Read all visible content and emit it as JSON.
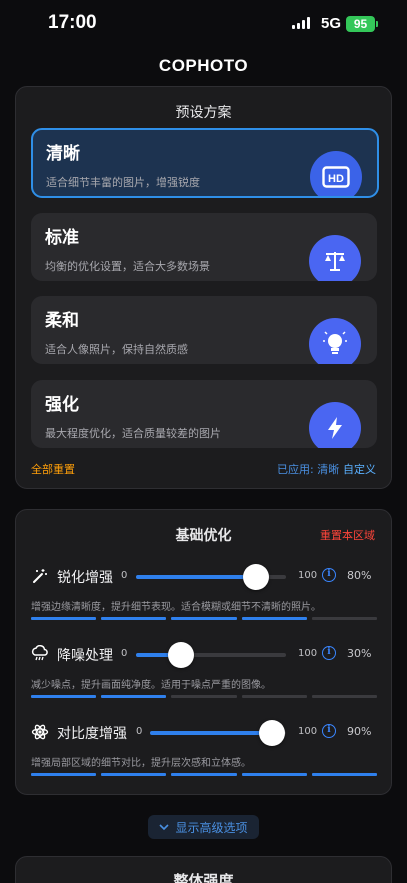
{
  "status": {
    "time": "17:00",
    "network": "5G",
    "battery": "95"
  },
  "app": {
    "title": "COPHOTO"
  },
  "presets": {
    "title": "预设方案",
    "items": [
      {
        "name": "清晰",
        "desc": "适合细节丰富的图片，增强锐度",
        "icon": "hd-icon",
        "selected": true
      },
      {
        "name": "标准",
        "desc": "均衡的优化设置，适合大多数场景",
        "icon": "balance-scale-icon",
        "selected": false
      },
      {
        "name": "柔和",
        "desc": "适合人像照片，保持自然质感",
        "icon": "lightbulb-icon",
        "selected": false
      },
      {
        "name": "强化",
        "desc": "最大程度优化，适合质量较差的图片",
        "icon": "lightning-icon",
        "selected": false
      }
    ],
    "reset_all": "全部重置",
    "applied": "已应用: 清晰",
    "custom": "自定义"
  },
  "basic": {
    "title": "基础优化",
    "reset_section": "重置本区域",
    "sliders": [
      {
        "label": "锐化增强",
        "icon": "magic-wand-icon",
        "min": "0",
        "max": "100",
        "value": 80,
        "value_text": "80%",
        "desc": "增强边缘清晰度，提升细节表现。适合模糊或细节不清晰的照片。",
        "segments": 4
      },
      {
        "label": "降噪处理",
        "icon": "cloud-rain-icon",
        "min": "0",
        "max": "100",
        "value": 30,
        "value_text": "30%",
        "desc": "减少噪点，提升画面纯净度。适用于噪点严重的图像。",
        "segments": 2
      },
      {
        "label": "对比度增强",
        "icon": "atom-icon",
        "min": "0",
        "max": "100",
        "value": 90,
        "value_text": "90%",
        "desc": "增强局部区域的细节对比，提升层次感和立体感。",
        "segments": 5
      }
    ]
  },
  "advanced": {
    "label": "显示高级选项"
  },
  "next_section": {
    "title": "整体强度"
  },
  "colors": {
    "accent": "#2f80ed",
    "orange": "#ff9f0a",
    "red": "#ff453a",
    "card": "#1c1c1e"
  }
}
